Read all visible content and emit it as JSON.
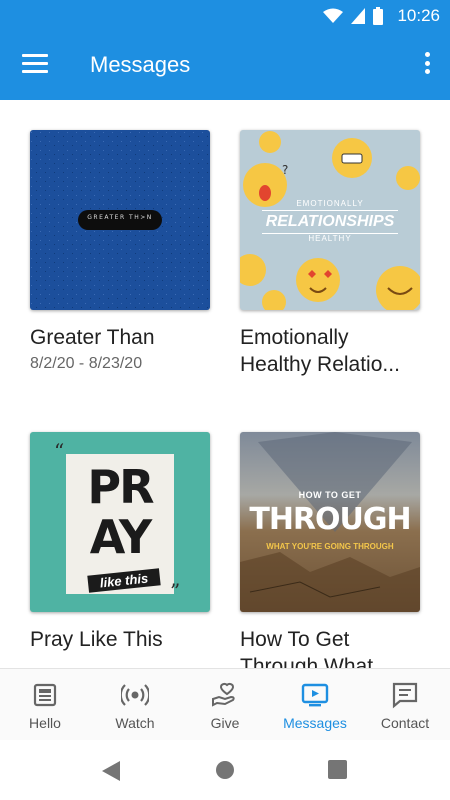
{
  "status_bar": {
    "time": "10:26"
  },
  "app_bar": {
    "title": "Messages"
  },
  "cards": [
    {
      "title": "Greater Than",
      "date": "8/2/20 - 8/23/20",
      "art_text": "GREATER TH>N"
    },
    {
      "title": "Emotionally Healthy Relatio...",
      "date": "",
      "art_top": "EMOTIONALLY",
      "art_main": "RELATIONSHIPS",
      "art_bottom": "HEALTHY"
    },
    {
      "title": "Pray Like This",
      "date": "",
      "art_main_1": "PR",
      "art_main_2": "AY",
      "art_sub": "like this"
    },
    {
      "title": "How To Get Through What ...",
      "date": "",
      "art_top": "HOW TO GET",
      "art_main": "THROUGH",
      "art_bottom": "WHAT YOU'RE GOING THROUGH"
    }
  ],
  "bottom_nav": {
    "items": [
      {
        "label": "Hello",
        "icon": "newspaper-icon"
      },
      {
        "label": "Watch",
        "icon": "broadcast-icon"
      },
      {
        "label": "Give",
        "icon": "give-heart-icon"
      },
      {
        "label": "Messages",
        "icon": "tv-play-icon",
        "active": true
      },
      {
        "label": "Contact",
        "icon": "chat-icon"
      }
    ]
  },
  "colors": {
    "primary": "#1e8fe1",
    "active_nav": "#1e8fe1"
  }
}
